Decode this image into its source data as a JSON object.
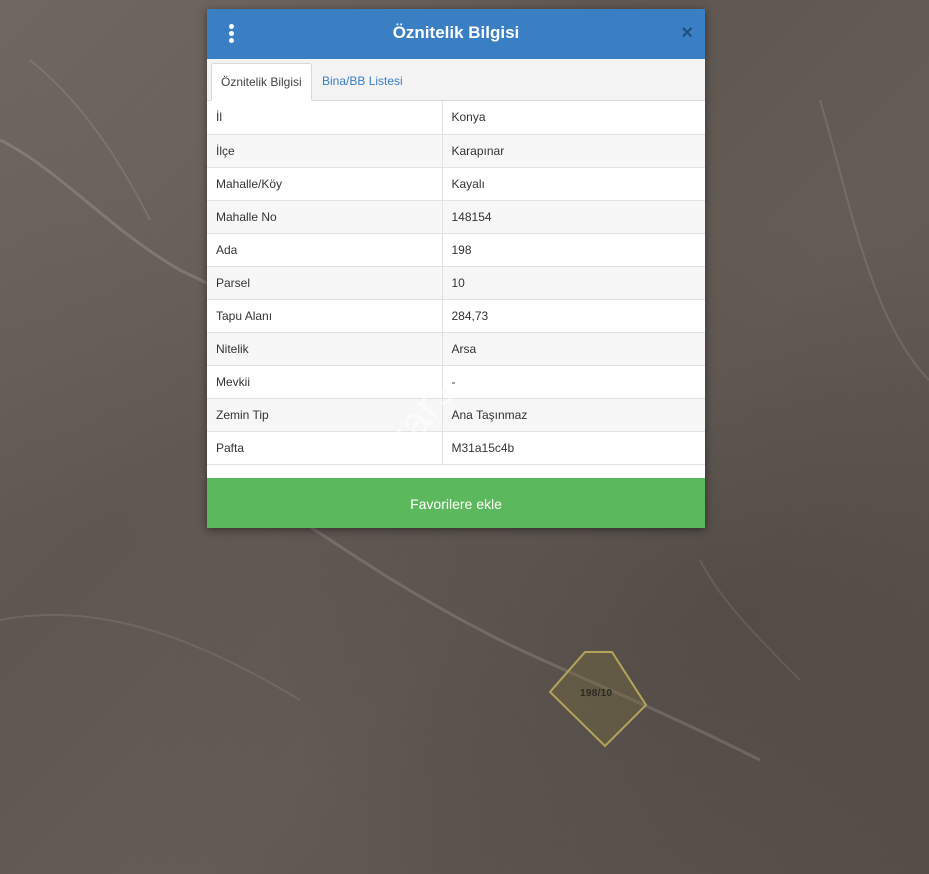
{
  "dialog": {
    "title": "Öznitelik Bilgisi",
    "close_symbol": "×",
    "menu_icon": "kebab-menu-icon",
    "header_color": "#3a7fc4",
    "tabs": [
      {
        "label": "Öznitelik Bilgisi",
        "active": true
      },
      {
        "label": "Bina/BB Listesi",
        "active": false
      }
    ],
    "rows": [
      {
        "key": "İl",
        "value": "Konya"
      },
      {
        "key": "İlçe",
        "value": "Karapınar"
      },
      {
        "key": "Mahalle/Köy",
        "value": "Kayalı"
      },
      {
        "key": "Mahalle No",
        "value": "148154"
      },
      {
        "key": "Ada",
        "value": "198"
      },
      {
        "key": "Parsel",
        "value": "10"
      },
      {
        "key": "Tapu Alanı",
        "value": "284,73"
      },
      {
        "key": "Nitelik",
        "value": "Arsa"
      },
      {
        "key": "Mevkii",
        "value": "-"
      },
      {
        "key": "Zemin Tip",
        "value": "Ana Taşınmaz"
      },
      {
        "key": "Pafta",
        "value": "M31a15c4b"
      }
    ],
    "favorites_label": "Favorilere ekle",
    "favorites_color": "#5cb85c"
  },
  "map": {
    "parcel_label": "198/10",
    "watermark": "trars"
  }
}
